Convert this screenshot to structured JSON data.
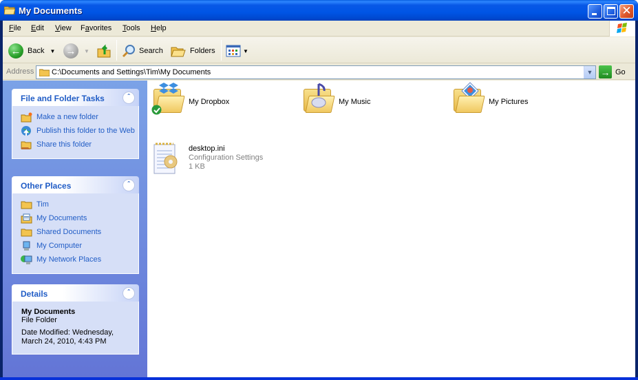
{
  "window": {
    "title": "My Documents",
    "controls": {
      "minimize": "minimize",
      "maximize": "maximize",
      "close": "✕"
    }
  },
  "menu": {
    "items": [
      {
        "label": "File",
        "accel": "F"
      },
      {
        "label": "Edit",
        "accel": "E"
      },
      {
        "label": "View",
        "accel": "V"
      },
      {
        "label": "Favorites",
        "accel": "a"
      },
      {
        "label": "Tools",
        "accel": "T"
      },
      {
        "label": "Help",
        "accel": "H"
      }
    ]
  },
  "toolbar": {
    "back_label": "Back",
    "search_label": "Search",
    "folders_label": "Folders"
  },
  "address": {
    "label": "Address",
    "value": "C:\\Documents and Settings\\Tim\\My Documents",
    "go_label": "Go"
  },
  "left_pane": {
    "tasks": {
      "title": "File and Folder Tasks",
      "items": [
        {
          "label": "Make a new folder",
          "icon": "new-folder-icon"
        },
        {
          "label": "Publish this folder to the Web",
          "icon": "publish-web-icon"
        },
        {
          "label": "Share this folder",
          "icon": "share-folder-icon"
        }
      ]
    },
    "other_places": {
      "title": "Other Places",
      "items": [
        {
          "label": "Tim",
          "icon": "folder-icon"
        },
        {
          "label": "My Documents",
          "icon": "my-documents-icon"
        },
        {
          "label": "Shared Documents",
          "icon": "folder-icon"
        },
        {
          "label": "My Computer",
          "icon": "computer-icon"
        },
        {
          "label": "My Network Places",
          "icon": "network-icon"
        }
      ]
    },
    "details": {
      "title": "Details",
      "name": "My Documents",
      "type": "File Folder",
      "modified_line1": "Date Modified: Wednesday,",
      "modified_line2": "March 24, 2010, 4:43 PM"
    }
  },
  "files": [
    {
      "name": "My Dropbox",
      "icon": "dropbox-folder-icon"
    },
    {
      "name": "My Music",
      "icon": "music-folder-icon"
    },
    {
      "name": "My Pictures",
      "icon": "pictures-folder-icon"
    },
    {
      "name": "desktop.ini",
      "type": "Configuration Settings",
      "size": "1 KB",
      "icon": "config-file-icon"
    }
  ]
}
